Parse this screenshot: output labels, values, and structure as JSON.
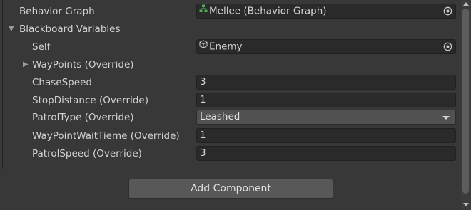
{
  "inspector": {
    "behavior_graph": {
      "label": "Behavior Graph",
      "value": "Mellee (Behavior Graph)",
      "icon": "behavior-graph-icon"
    },
    "blackboard": {
      "foldout_label": "Blackboard Variables",
      "expanded": true,
      "variables": {
        "self": {
          "label": "Self",
          "value": "Enemy",
          "icon": "cube-icon"
        },
        "waypoints": {
          "label": "WayPoints (Override)",
          "expanded": false
        },
        "chase_speed": {
          "label": "ChaseSpeed",
          "value": "3"
        },
        "stop_distance": {
          "label": "StopDistance (Override)",
          "value": "1"
        },
        "patrol_type": {
          "label": "PatrolType (Override)",
          "value": "Leashed"
        },
        "waypoint_wait_time": {
          "label": "WayPointWaitTieme (Override)",
          "value": "1"
        },
        "patrol_speed": {
          "label": "PatrolSpeed (Override)",
          "value": "3"
        }
      }
    },
    "add_component_label": "Add Component"
  },
  "colors": {
    "background": "#383838",
    "field_background": "#2a2a2a",
    "dropdown_background": "#515151",
    "button_background": "#585858",
    "text": "#d2d2d2",
    "graph_icon_green": "#4caf50"
  }
}
